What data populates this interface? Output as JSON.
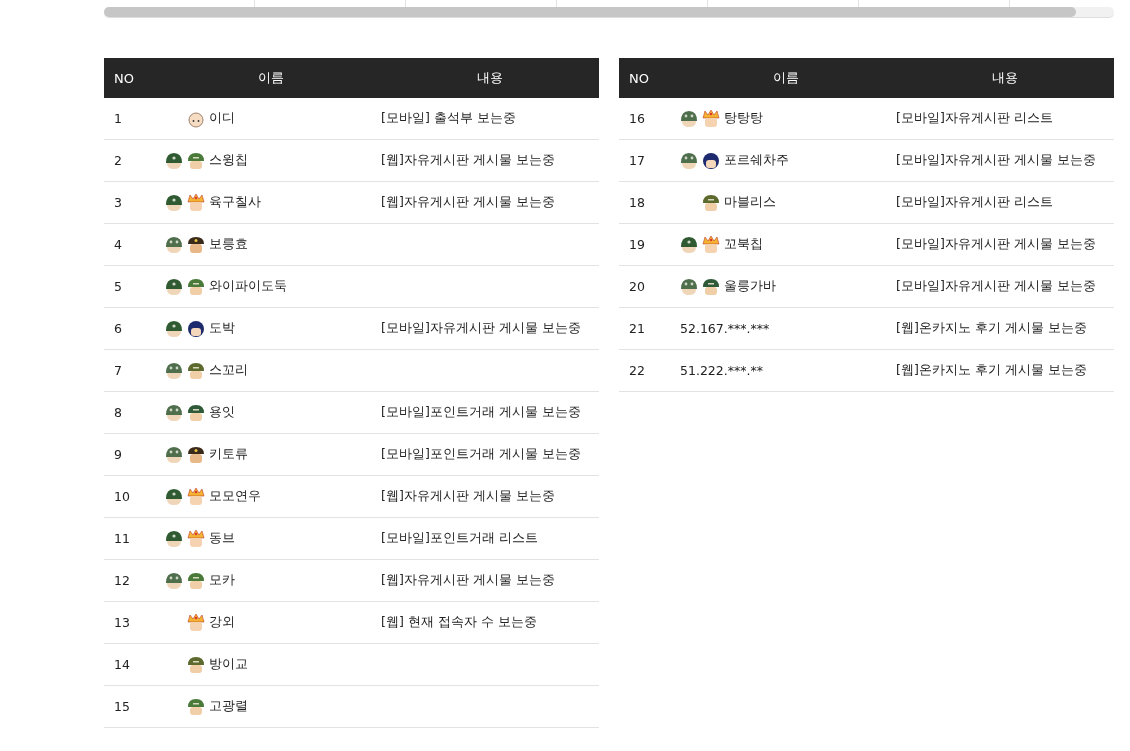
{
  "tables": [
    {
      "columns": [
        "NO",
        "이름",
        "내용"
      ],
      "rows": [
        {
          "no": "1",
          "icons": [
            {
              "kind": "baby"
            }
          ],
          "name": "이디",
          "activity": "[모바일] 출석부 보는중"
        },
        {
          "no": "2",
          "icons": [
            {
              "kind": "helmet"
            },
            {
              "kind": "soldier"
            }
          ],
          "name": "스윙칩",
          "activity": "[웹]자유게시판 게시물 보는중"
        },
        {
          "no": "3",
          "icons": [
            {
              "kind": "helmet"
            },
            {
              "kind": "crown"
            }
          ],
          "name": "육구칠사",
          "activity": "[웹]자유게시판 게시물 보는중"
        },
        {
          "no": "4",
          "icons": [
            {
              "kind": "helmet2"
            },
            {
              "kind": "officer"
            }
          ],
          "name": "보릉효"
        },
        {
          "no": "5",
          "icons": [
            {
              "kind": "helmet"
            },
            {
              "kind": "soldier"
            }
          ],
          "name": "와이파이도둑"
        },
        {
          "no": "6",
          "icons": [
            {
              "kind": "helmet"
            },
            {
              "kind": "bluehair"
            }
          ],
          "name": "도박",
          "activity": "[모바일]자유게시판 게시물 보는중"
        },
        {
          "no": "7",
          "icons": [
            {
              "kind": "helmet2"
            },
            {
              "kind": "camo"
            }
          ],
          "name": "스꼬리"
        },
        {
          "no": "8",
          "icons": [
            {
              "kind": "helmet2"
            },
            {
              "kind": "starcap"
            }
          ],
          "name": "용잇",
          "activity": "[모바일]포인트거래 게시물 보는중"
        },
        {
          "no": "9",
          "icons": [
            {
              "kind": "helmet2"
            },
            {
              "kind": "officer"
            }
          ],
          "name": "키토류",
          "activity": "[모바일]포인트거래 게시물 보는중"
        },
        {
          "no": "10",
          "icons": [
            {
              "kind": "helmet"
            },
            {
              "kind": "crown"
            }
          ],
          "name": "모모연우",
          "activity": "[웹]자유게시판 게시물 보는중"
        },
        {
          "no": "11",
          "icons": [
            {
              "kind": "helmet"
            },
            {
              "kind": "crown"
            }
          ],
          "name": "동브",
          "activity": "[모바일]포인트거래 리스트"
        },
        {
          "no": "12",
          "icons": [
            {
              "kind": "helmet2"
            },
            {
              "kind": "soldier"
            }
          ],
          "name": "모카",
          "activity": "[웹]자유게시판 게시물 보는중"
        },
        {
          "no": "13",
          "icons": [
            {
              "kind": "crown"
            }
          ],
          "name": "강외",
          "activity": "[웹] 현재 접속자 수 보는중"
        },
        {
          "no": "14",
          "icons": [
            {
              "kind": "camo"
            }
          ],
          "name": "방이교"
        },
        {
          "no": "15",
          "icons": [
            {
              "kind": "soldier"
            }
          ],
          "name": "고광렬"
        }
      ]
    },
    {
      "columns": [
        "NO",
        "이름",
        "내용"
      ],
      "rows": [
        {
          "no": "16",
          "icons": [
            {
              "kind": "helmet2"
            },
            {
              "kind": "crown"
            }
          ],
          "name": "탕탕탕",
          "activity": "[모바일]자유게시판 리스트"
        },
        {
          "no": "17",
          "icons": [
            {
              "kind": "helmet2"
            },
            {
              "kind": "bluehair"
            }
          ],
          "name": "포르쉐차주",
          "activity": "[모바일]자유게시판 게시물 보는중"
        },
        {
          "no": "18",
          "icons": [
            {
              "kind": "camo"
            }
          ],
          "name": "마블리스",
          "activity": "[모바일]자유게시판 리스트"
        },
        {
          "no": "19",
          "icons": [
            {
              "kind": "helmet"
            },
            {
              "kind": "crown"
            }
          ],
          "name": "꼬북칩",
          "activity": "[모바일]자유게시판 게시물 보는중"
        },
        {
          "no": "20",
          "icons": [
            {
              "kind": "helmet2"
            },
            {
              "kind": "starcap"
            }
          ],
          "name": "울릉가바",
          "activity": "[모바일]자유게시판 게시물 보는중"
        },
        {
          "no": "21",
          "icons": [],
          "name": "52.167.***.***",
          "activity": "[웹]온카지노 후기 게시물 보는중"
        },
        {
          "no": "22",
          "icons": [],
          "name": "51.222.***.**",
          "activity": "[웹]온카지노 후기 게시물 보는중"
        }
      ]
    }
  ]
}
